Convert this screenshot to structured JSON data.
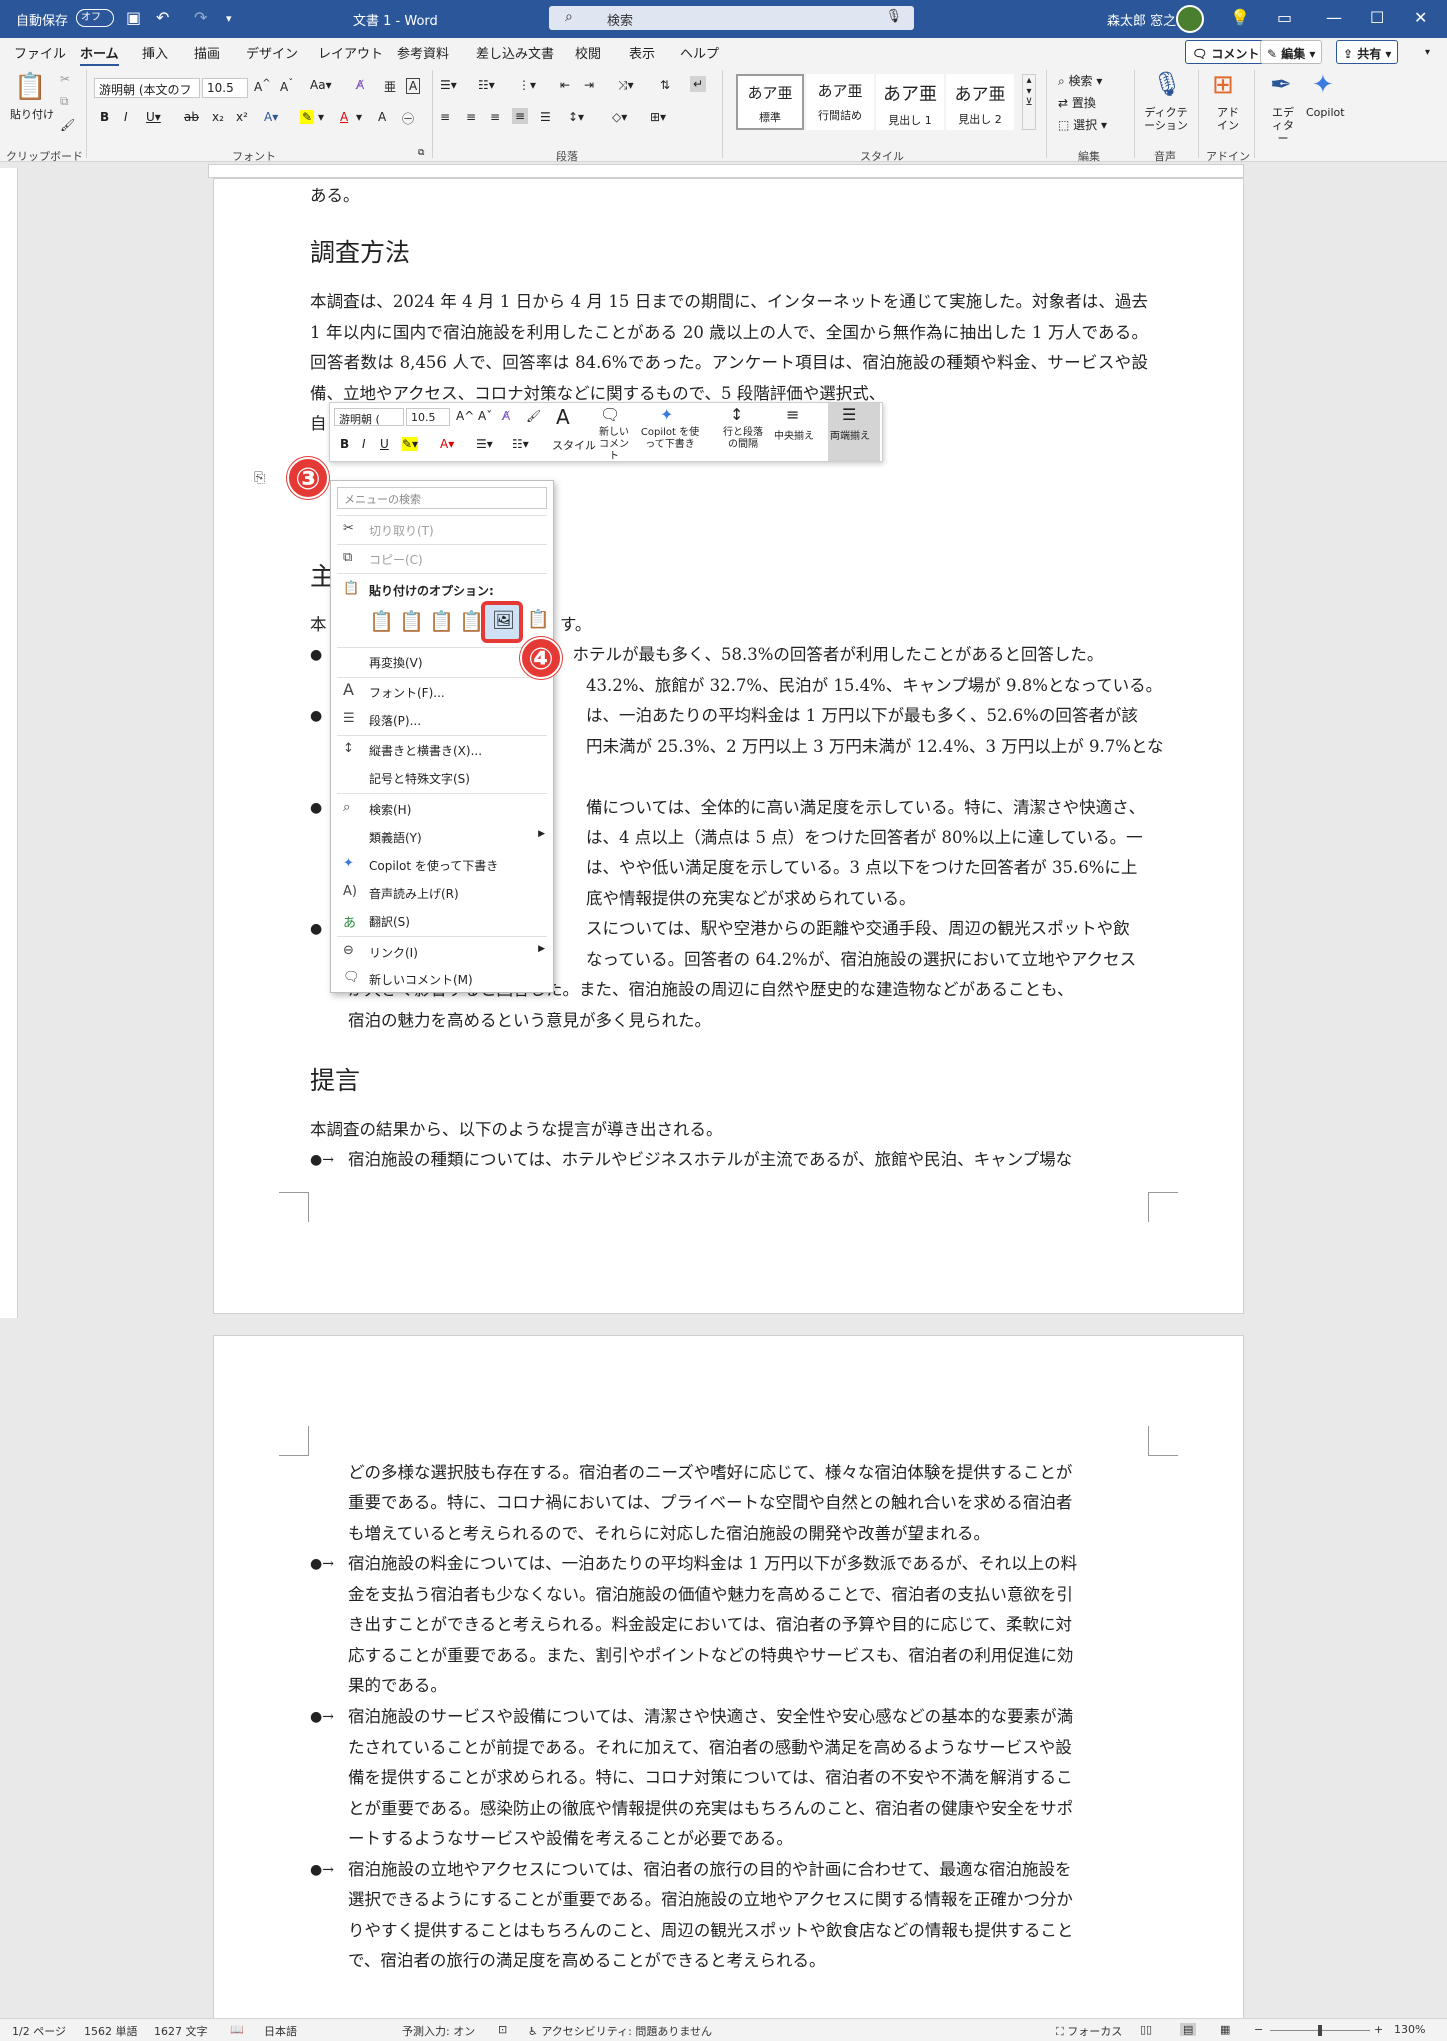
{
  "titlebar": {
    "autosave_label": "自動保存",
    "autosave_state": "オフ",
    "doc_title": "文書 1 - Word",
    "search_placeholder": "検索",
    "user_name": "森太郎 窓之"
  },
  "tabs": [
    "ファイル",
    "ホーム",
    "挿入",
    "描画",
    "デザイン",
    "レイアウト",
    "参考資料",
    "差し込み文書",
    "校閲",
    "表示",
    "ヘルプ"
  ],
  "actions": {
    "comment": "コメント",
    "edit": "編集",
    "share": "共有"
  },
  "ribbon": {
    "paste_label": "貼り付け",
    "clipboard_group": "クリップボード",
    "font_name": "游明朝 (本文のフ",
    "font_size": "10.5",
    "font_group": "フォント",
    "paragraph_group": "段落",
    "styles": [
      {
        "sample": "あア亜",
        "name": "標準"
      },
      {
        "sample": "あア亜",
        "name": "行間詰め"
      },
      {
        "sample": "あア亜",
        "name": "見出し 1"
      },
      {
        "sample": "あア亜",
        "name": "見出し 2"
      }
    ],
    "styles_group": "スタイル",
    "editing": {
      "find": "検索",
      "replace": "置換",
      "select": "選択",
      "group": "編集"
    },
    "dictate": "ディクテーション",
    "voice_group": "音声",
    "addins": "アドイン",
    "addins_group": "アドイン",
    "editor": "エディター",
    "copilot": "Copilot"
  },
  "page1": {
    "top_text": "ある。",
    "heading1": "調査方法",
    "para1": "本調査は、2024 年 4 月 1 日から 4 月 15 日までの期間に、インターネットを通じて実施した。対象者は、過去 1 年以内に国内で宿泊施設を利用したことがある 20 歳以上の人で、全国から無作為に抽出した 1 万人である。回答者数は 8,456 人で、回答率は 84.6%であった。アンケート項目は、宿泊施設の種類や料金、サービスや設備、立地やアクセス、コロナ対策などに関するもので、5 段階評価や選択式、",
    "para1_tail": "自",
    "heading2_partial": "主",
    "line_a": "本",
    "line_a_tail": "す。",
    "bullets": [
      "、ホテルが最も多く、58.3%の回答者が利用したことがあると回答した。",
      "43.2%、旅館が 32.7%、民泊が 15.4%、キャンプ場が 9.8%となっている。",
      "は、一泊あたりの平均料金は 1 万円以下が最も多く、52.6%の回答者が該",
      "円未満が 25.3%、2 万円以上 3 万円未満が 12.4%、3 万円以上が 9.7%とな",
      "備については、全体的に高い満足度を示している。特に、清潔さや快適さ、",
      "は、4 点以上（満点は 5 点）をつけた回答者が 80%以上に達している。一",
      "は、やや低い満足度を示している。3 点以下をつけた回答者が 35.6%に上",
      "底や情報提供の充実などが求められている。",
      "スについては、駅や空港からの距離や交通手段、周辺の観光スポットや飲",
      "なっている。回答者の 64.2%が、宿泊施設の選択において立地やアクセス",
      "が大きく影響すると回答した。また、宿泊施設の周辺に自然や歴史的な建造物などがあることも、",
      "宿泊の魅力を高めるという意見が多く見られた。"
    ],
    "heading3": "提言",
    "para3": "本調査の結果から、以下のような提言が導き出される。",
    "bullet3": "宿泊施設の種類については、ホテルやビジネスホテルが主流であるが、旅館や民泊、キャンプ場な"
  },
  "page2": {
    "lines": [
      "どの多様な選択肢も存在する。宿泊者のニーズや嗜好に応じて、様々な宿泊体験を提供することが",
      "重要である。特に、コロナ禍においては、プライベートな空間や自然との触れ合いを求める宿泊者",
      "も増えていると考えられるので、それらに対応した宿泊施設の開発や改善が望まれる。"
    ],
    "bullets": [
      [
        "宿泊施設の料金については、一泊あたりの平均料金は 1 万円以下が多数派であるが、それ以上の料",
        "金を支払う宿泊者も少なくない。宿泊施設の価値や魅力を高めることで、宿泊者の支払い意欲を引",
        "き出すことができると考えられる。料金設定においては、宿泊者の予算や目的に応じて、柔軟に対",
        "応することが重要である。また、割引やポイントなどの特典やサービスも、宿泊者の利用促進に効",
        "果的である。"
      ],
      [
        "宿泊施設のサービスや設備については、清潔さや快適さ、安全性や安心感などの基本的な要素が満",
        "たされていることが前提である。それに加えて、宿泊者の感動や満足を高めるようなサービスや設",
        "備を提供することが求められる。特に、コロナ対策については、宿泊者の不安や不満を解消するこ",
        "とが重要である。感染防止の徹底や情報提供の充実はもちろんのこと、宿泊者の健康や安全をサポ",
        "ートするようなサービスや設備を考えることが必要である。"
      ],
      [
        "宿泊施設の立地やアクセスについては、宿泊者の旅行の目的や計画に合わせて、最適な宿泊施設を",
        "選択できるようにすることが重要である。宿泊施設の立地やアクセスに関する情報を正確かつ分か",
        "りやすく提供することはもちろんのこと、周辺の観光スポットや飲食店などの情報も提供すること",
        "で、宿泊者の旅行の満足度を高めることができると考えられる。"
      ]
    ]
  },
  "minitoolbar": {
    "font": "游明朝 (",
    "size": "10.5",
    "style": "スタイル",
    "new_comment": "新しいコメント",
    "copilot": "Copilot を使って下書き",
    "line_spacing": "行と段落の間隔",
    "center": "中央揃え",
    "justify": "両端揃え"
  },
  "contextmenu": {
    "search_placeholder": "メニューの検索",
    "cut": "切り取り(T)",
    "copy": "コピー(C)",
    "paste_options": "貼り付けのオプション:",
    "reconvert": "再変換(V)",
    "font": "フォント(F)...",
    "paragraph": "段落(P)...",
    "text_direction": "縦書きと横書き(X)...",
    "symbol": "記号と特殊文字(S)",
    "search": "検索(H)",
    "synonyms": "類義語(Y)",
    "copilot": "Copilot を使って下書き",
    "read_aloud": "音声読み上げ(R)",
    "translate": "翻訳(S)",
    "link": "リンク(I)",
    "new_comment": "新しいコメント(M)"
  },
  "badges": {
    "step3": "③",
    "step4": "④"
  },
  "statusbar": {
    "page": "1/2 ページ",
    "words": "1562 単語",
    "chars": "1627 文字",
    "lang": "日本語",
    "predict": "予測入力: オン",
    "accessibility": "アクセシビリティ: 問題ありません",
    "focus": "フォーカス",
    "zoom": "130%"
  },
  "colors": {
    "accent": "#2b579a",
    "highlight": "#e53935"
  }
}
